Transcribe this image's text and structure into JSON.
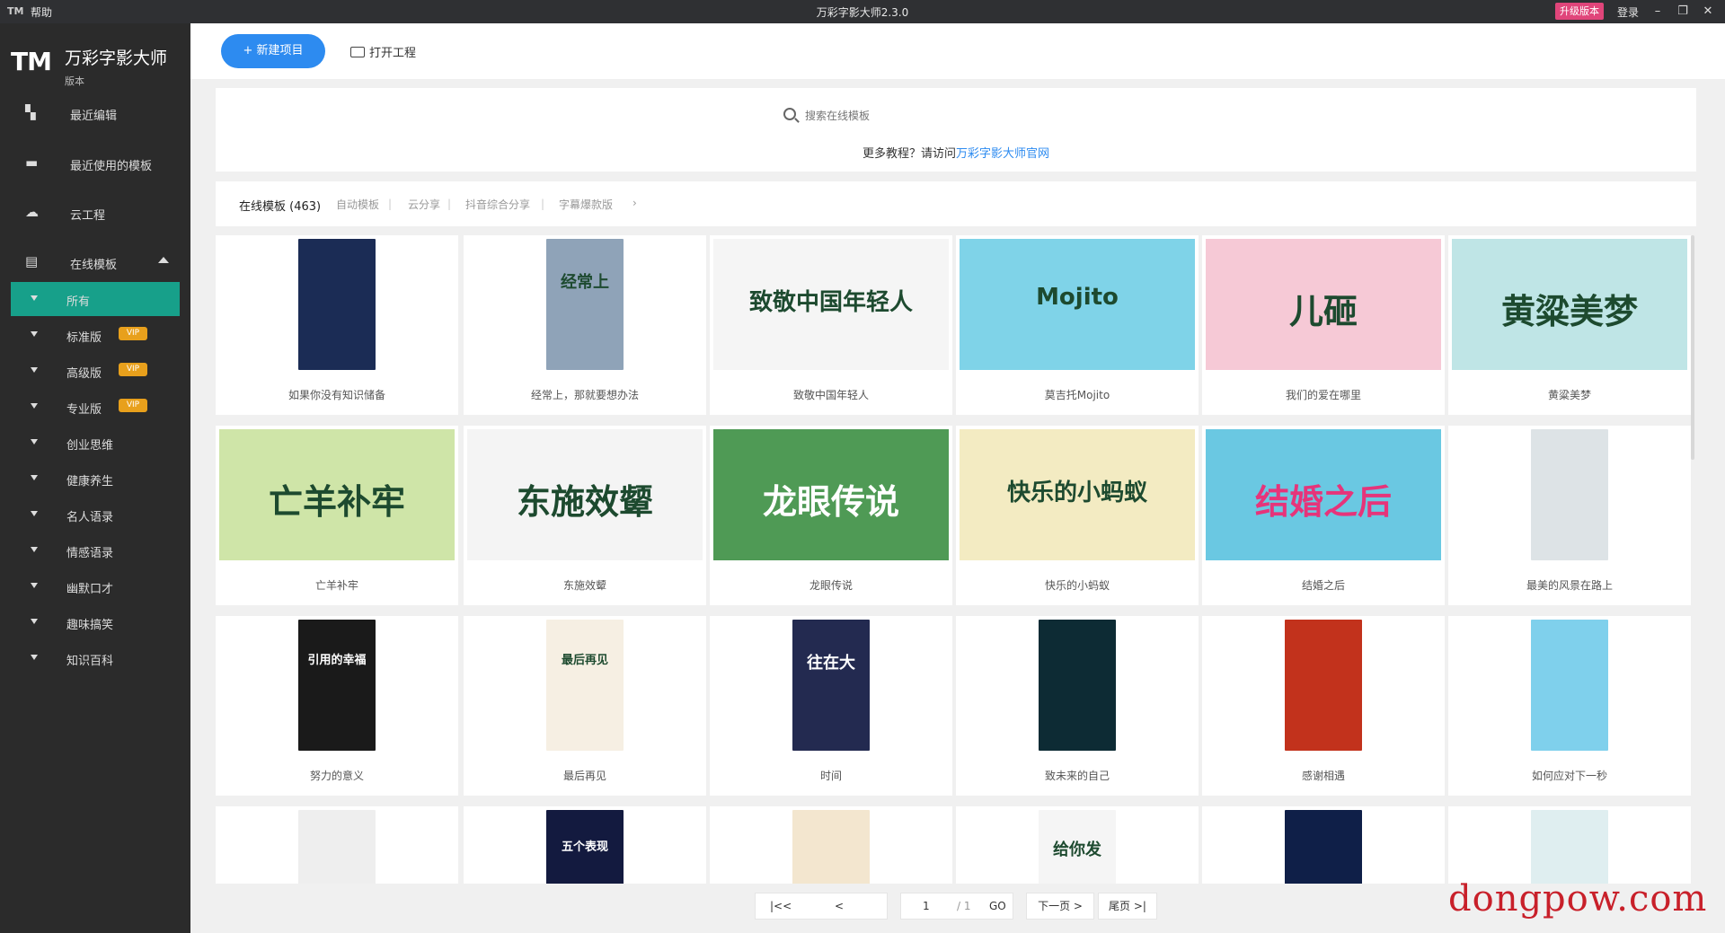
{
  "titlebar": {
    "logo": "TM",
    "help": "帮助",
    "title": "万彩字影大师2.3.0",
    "buy": "升级版本",
    "login": "登录",
    "minimize": "–",
    "maximize": "❐",
    "close": "✕"
  },
  "brand": {
    "logo": "TM",
    "name": "万彩字影大师",
    "version": "版本"
  },
  "nav": {
    "recent": "最近编辑",
    "recent_templates": "最近使用的模板",
    "cloud": "云工程",
    "online_templates": "在线模板",
    "sub": [
      {
        "label": "所有",
        "badge": ""
      },
      {
        "label": "标准版",
        "badge": "VIP"
      },
      {
        "label": "高级版",
        "badge": "VIP"
      },
      {
        "label": "专业版",
        "badge": "VIP"
      },
      {
        "label": "创业思维",
        "badge": ""
      },
      {
        "label": "健康养生",
        "badge": ""
      },
      {
        "label": "名人语录",
        "badge": ""
      },
      {
        "label": "情感语录",
        "badge": ""
      },
      {
        "label": "幽默口才",
        "badge": ""
      },
      {
        "label": "趣味搞笑",
        "badge": ""
      },
      {
        "label": "知识百科",
        "badge": ""
      }
    ]
  },
  "toolbar": {
    "new": "+ 新建项目",
    "open": "打开工程"
  },
  "search": {
    "placeholder": "搜索在线模板",
    "tutorial_prefix": "更多教程？请访问",
    "tutorial_link": "万彩字影大师官网"
  },
  "filter": {
    "current": "在线模板 (463)",
    "tags": [
      "自动模板",
      "云分享",
      "抖音综合分享",
      "字幕爆款版"
    ],
    "more": "›"
  },
  "colors": {
    "accent": "#2d8bf0",
    "active_nav": "#17a08a",
    "vip": "#e8a01c",
    "sidebar": "#2b2b2b"
  },
  "cards": [
    {
      "title": "如果你没有知识储备",
      "thumb_text": "",
      "kind": "portrait",
      "bg": "#1b2c55"
    },
    {
      "title": "经常上，那就要想办法",
      "thumb_text": "经常上",
      "kind": "portrait",
      "bg": "#8fa3b8"
    },
    {
      "title": "致敬中国年轻人",
      "thumb_text": "致敬中国年轻人",
      "kind": "land",
      "bg": "#f5f5f5"
    },
    {
      "title": "莫吉托Mojito",
      "thumb_text": "Mojito",
      "kind": "land",
      "bg": "#7fd3e8"
    },
    {
      "title": "我们的爱在哪里",
      "thumb_text": "儿砸",
      "kind": "land",
      "bg": "#f6c9d6"
    },
    {
      "title": "黄粱美梦",
      "thumb_text": "黄粱美梦",
      "kind": "land",
      "bg": "#bfe5e6"
    },
    {
      "title": "亡羊补牢",
      "thumb_text": "亡羊补牢",
      "kind": "land",
      "bg": "#cfe5a8"
    },
    {
      "title": "东施效颦",
      "thumb_text": "东施效颦",
      "kind": "land",
      "bg": "#f4f4f4"
    },
    {
      "title": "龙眼传说",
      "thumb_text": "龙眼传说",
      "kind": "land",
      "bg": "#4f9a55"
    },
    {
      "title": "快乐的小蚂蚁",
      "thumb_text": "快乐的小蚂蚁",
      "kind": "land",
      "bg": "#f3ebc2"
    },
    {
      "title": "结婚之后",
      "thumb_text": "结婚之后",
      "kind": "land",
      "bg": "#6ac8e2"
    },
    {
      "title": "最美的风景在路上",
      "thumb_text": "",
      "kind": "portrait",
      "bg": "#dde3e6"
    },
    {
      "title": "努力的意义",
      "thumb_text": "引用的幸福",
      "kind": "portrait",
      "bg": "#1a1a1a"
    },
    {
      "title": "最后再见",
      "thumb_text": "最后再见",
      "kind": "portrait",
      "bg": "#f6efe3"
    },
    {
      "title": "时间",
      "thumb_text": "往在大",
      "kind": "portrait",
      "bg": "#232a50"
    },
    {
      "title": "致未来的自己",
      "thumb_text": "",
      "kind": "portrait",
      "bg": "#0d2b34"
    },
    {
      "title": "感谢相遇",
      "thumb_text": "",
      "kind": "portrait",
      "bg": "#c2321c"
    },
    {
      "title": "如何应对下一秒",
      "thumb_text": "",
      "kind": "portrait",
      "bg": "#7fd0ec"
    },
    {
      "title": "",
      "thumb_text": "",
      "kind": "portrait",
      "bg": "#eeeeee"
    },
    {
      "title": "",
      "thumb_text": "五个表现",
      "kind": "portrait",
      "bg": "#131a3f"
    },
    {
      "title": "",
      "thumb_text": "",
      "kind": "portrait",
      "bg": "#f3e6cf"
    },
    {
      "title": "",
      "thumb_text": "给你发",
      "kind": "portrait",
      "bg": "#f5f5f5"
    },
    {
      "title": "",
      "thumb_text": "",
      "kind": "portrait",
      "bg": "#0f1f48"
    },
    {
      "title": "",
      "thumb_text": "",
      "kind": "portrait",
      "bg": "#dfeef0"
    }
  ],
  "pagination": {
    "first": "|<<",
    "prev": "<",
    "current": "1",
    "total": "/ 1",
    "go": "GO",
    "next": "下一页 >",
    "last": "尾页 >|"
  },
  "watermark": "dongpow.com"
}
